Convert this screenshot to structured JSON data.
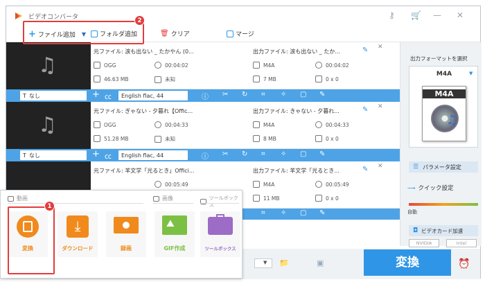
{
  "app_title": "ビデオコンバータ",
  "toolbar": {
    "add_file": "ファイル追加",
    "add_folder": "フォルダ追加",
    "clear": "クリア",
    "merge": "マージ"
  },
  "badges": {
    "one": "1",
    "two": "2"
  },
  "files": [
    {
      "src_name": "元ファイル: 涙も出ない _ たかやん (0...",
      "out_name": "出力ファイル: 涙も出ない _ たか...",
      "src_format": "OGG",
      "src_duration": "00:04:02",
      "src_size": "46.63 MB",
      "src_resolution": "未知",
      "out_format": "M4A",
      "out_duration": "00:04:02",
      "out_size": "7 MB",
      "out_resolution": "0 x 0",
      "subtitle": "なし",
      "audio": "English flac, 44"
    },
    {
      "src_name": "元ファイル: ぎゃない - 夕暮れ【Offic...",
      "out_name": "出力ファイル: きゃない - 夕暮れ...",
      "src_format": "OGG",
      "src_duration": "00:04:33",
      "src_size": "51.28 MB",
      "src_resolution": "未知",
      "out_format": "M4A",
      "out_duration": "00:04:33",
      "out_size": "8 MB",
      "out_resolution": "0 x 0",
      "subtitle": "なし",
      "audio": "English flac, 44"
    },
    {
      "src_name": "元ファイル: 羊文学「光るとき」Offici...",
      "out_name": "出力ファイル: 羊文学「光るとき...",
      "src_format": "",
      "src_duration": "00:05:49",
      "src_size": "",
      "src_resolution": "",
      "out_format": "M4A",
      "out_duration": "00:05:49",
      "out_size": "11 MB",
      "out_resolution": "0 x 0",
      "subtitle": "",
      "audio": ""
    }
  ],
  "sidebar": {
    "output_label": "出力フォーマットを選択",
    "format": "M4A",
    "format_icon_label": "M4A",
    "param_settings": "パラメータ設定",
    "quick_settings": "クイック設定",
    "auto": "自動",
    "gpu_accel": "ビデオカード加速",
    "nvidia": "NVIDIA",
    "intel": "Intel"
  },
  "convert_button": "変換",
  "popup": {
    "cat_video": "動画",
    "cat_image": "画像",
    "cat_toolbox": "ツールボックス",
    "tiles": [
      {
        "label": "変換",
        "color": "#f08a1c",
        "bg": "#f7f7f7"
      },
      {
        "label": "ダウンロード",
        "color": "#f08a1c",
        "bg": "#f7f7f7"
      },
      {
        "label": "録画",
        "color": "#f08a1c",
        "bg": "#f7f7f7"
      },
      {
        "label": "GIF作成",
        "color": "#7cc043",
        "bg": "#f7f7f7"
      },
      {
        "label": "ツールボックス",
        "color": "#9c6cc6",
        "bg": "#f7f7f7"
      }
    ]
  },
  "colors": {
    "accent": "#2f95e6",
    "ctrlbar": "#4da3e6",
    "annotation": "#e23c3c"
  }
}
